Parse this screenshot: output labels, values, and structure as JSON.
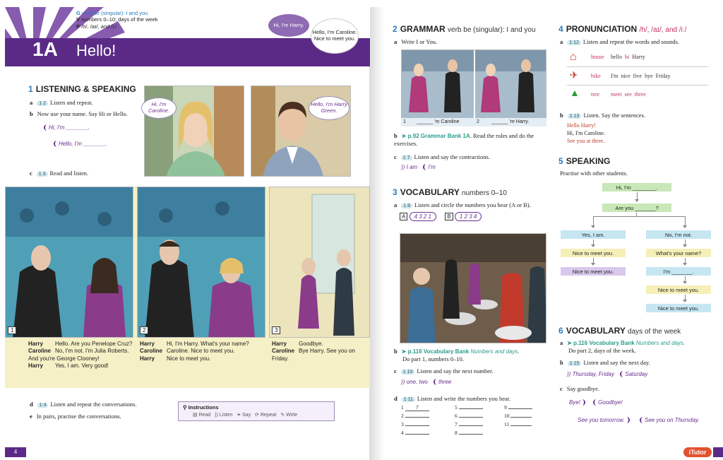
{
  "header": {
    "g_line_prefix": "G",
    "g_line": "verb be (singular): I and you",
    "v_line_prefix": "V",
    "v_line": "numbers 0–10; days of the week",
    "p_line_prefix": "P",
    "p_line": "/h/, /aɪ/, and /iː/",
    "unit": "1A",
    "title": "Hello!",
    "bubble_harry": "Hi, I'm Harry.",
    "bubble_caroline": "Hello, I'm Caroline. Nice to meet you."
  },
  "s1": {
    "num": "1",
    "title": "LISTENING & SPEAKING",
    "a_label": "a",
    "a_audio": "1 2",
    "a_text": "Listen and repeat.",
    "b_label": "b",
    "b_text": "Now use your name. Say Hi or Hello.",
    "b_bubble1": "Hi, I'm _______.",
    "b_bubble2": "Hello, I'm _______.",
    "c_label": "c",
    "c_audio": "1 3",
    "c_text": "Read and listen.",
    "photo1_bubble": "Hi, I'm Caroline.",
    "photo2_bubble": "Hello, I'm Harry Green."
  },
  "comic": {
    "p1_num": "1",
    "p2_num": "2",
    "p3_num": "3",
    "p1": [
      {
        "speaker": "Harry",
        "text": "Hello. Are you Penelope Cruz?"
      },
      {
        "speaker": "Caroline",
        "text": "No, I'm not. I'm Julia Roberts. And you're George Clooney!"
      },
      {
        "speaker": "Harry",
        "text": "Yes, I am. Very good!"
      }
    ],
    "p2": [
      {
        "speaker": "Harry",
        "text": "Hi, I'm Harry. What's your name?"
      },
      {
        "speaker": "Caroline",
        "text": "Caroline. Nice to meet you."
      },
      {
        "speaker": "Harry",
        "text": "Nice to meet you."
      }
    ],
    "p3": [
      {
        "speaker": "Harry",
        "text": "Goodbye."
      },
      {
        "speaker": "Caroline",
        "text": "Bye Harry. See you on Friday."
      }
    ]
  },
  "s1_bottom": {
    "d_label": "d",
    "d_audio": "1 4",
    "d_text": "Listen and repeat the conversations.",
    "e_label": "e",
    "e_text": "In pairs, practise the conversations."
  },
  "instructions": {
    "title": "Instructions",
    "read": "Read",
    "listen": "Listen",
    "say": "Say",
    "repeat": "Repeat",
    "write": "Write"
  },
  "page_left": "4",
  "s2": {
    "num": "2",
    "title": "GRAMMAR",
    "sub": "verb be (singular): I and you",
    "a_label": "a",
    "a_text": "Write I or You.",
    "cap1_num": "1",
    "cap1": "______ 'm Caroline",
    "cap2_num": "2",
    "cap2": "______ 're Harry.",
    "b_label": "b",
    "b_link": "➤ p.92 Grammar Bank 1A.",
    "b_text": "Read the rules and do the exercises.",
    "c_label": "c",
    "c_audio": "1 7",
    "c_text": "Listen and say the contractions.",
    "c_ex1": "I am",
    "c_ex2": "I'm"
  },
  "s3": {
    "num": "3",
    "title": "VOCABULARY",
    "sub": "numbers 0–10",
    "a_label": "a",
    "a_audio": "1 8",
    "a_text": "Listen and circle the numbers you hear (A or B).",
    "optA_letter": "A",
    "optA": "4 3 2 1",
    "optB_letter": "B",
    "optB": "1 2 3 4",
    "b_label": "b",
    "b_link": "➤ p.116 Vocabulary Bank",
    "b_link2": "Numbers and days.",
    "b_text": "Do part 1, numbers 0–10.",
    "c_label": "c",
    "c_audio": "1 10",
    "c_text": "Listen and say the next number.",
    "c_ex1": "one, two",
    "c_ex2": "three",
    "d_label": "d",
    "d_audio": "1 11",
    "d_text": "Listen and write the numbers you hear.",
    "nums": [
      "1",
      "2",
      "3",
      "4",
      "5",
      "6",
      "7",
      "8",
      "9",
      "10",
      "11"
    ],
    "first_answer": "7"
  },
  "s4": {
    "num": "4",
    "title": "PRONUNCIATION",
    "sub": "/h/, /aɪ/, and /iː/",
    "a_label": "a",
    "a_audio": "1 12",
    "a_text": "Listen and repeat the words and sounds.",
    "rows": [
      {
        "icon": "house-icon",
        "key": "house",
        "words": [
          "hello",
          "hi",
          "Harry"
        ]
      },
      {
        "icon": "bike-icon",
        "key": "bike",
        "words": [
          "I'm",
          "nice",
          "five",
          "bye",
          "Friday"
        ]
      },
      {
        "icon": "tree-icon",
        "key": "tree",
        "words": [
          "meet",
          "see",
          "three"
        ]
      }
    ],
    "b_label": "b",
    "b_audio": "1 13",
    "b_text": "Listen. Say the sentences.",
    "s1": "Hello Harry!",
    "s2": "Hi, I'm Caroline.",
    "s3": "See you at three."
  },
  "s5": {
    "num": "5",
    "title": "SPEAKING",
    "text": "Practise with other students.",
    "flow": {
      "hi": "Hi, I'm ________.",
      "are_you": "Are you _______?",
      "yes": "Yes, I am.",
      "no": "No, I'm not.",
      "ntmy1": "Nice to meet you.",
      "ntmy2": "Nice to meet you.",
      "whats": "What's your name?",
      "im": "I'm _______.",
      "ntmy3": "Nice to meet you.",
      "ntmy4": "Nice to meet you."
    }
  },
  "s6": {
    "num": "6",
    "title": "VOCABULARY",
    "sub": "days of the week",
    "a_label": "a",
    "a_link": "➤ p.116 Vocabulary Bank",
    "a_link2": "Numbers and days.",
    "a_text": "Do part 2, days of the week.",
    "b_label": "b",
    "b_audio": "1 15",
    "b_text": "Listen and say the next day.",
    "b_ex1": "Thursday, Friday",
    "b_ex2": "Saturday",
    "c_label": "c",
    "c_text": "Say goodbye.",
    "c_ex1": "Bye!",
    "c_ex2": "Goodbye!",
    "c_ex3": "See you tomorrow.",
    "c_ex4": "See you on Thursday."
  },
  "brand": "iTutor",
  "colors": {
    "banner": "#5b2a86",
    "section_num": "#2a7bbf",
    "grammar_link": "#2a9c8c",
    "flow_green": "#c9e8b9",
    "flow_blue": "#c6e6f2",
    "flow_purple": "#d9c8ec",
    "flow_yellow": "#f6f0b8"
  }
}
